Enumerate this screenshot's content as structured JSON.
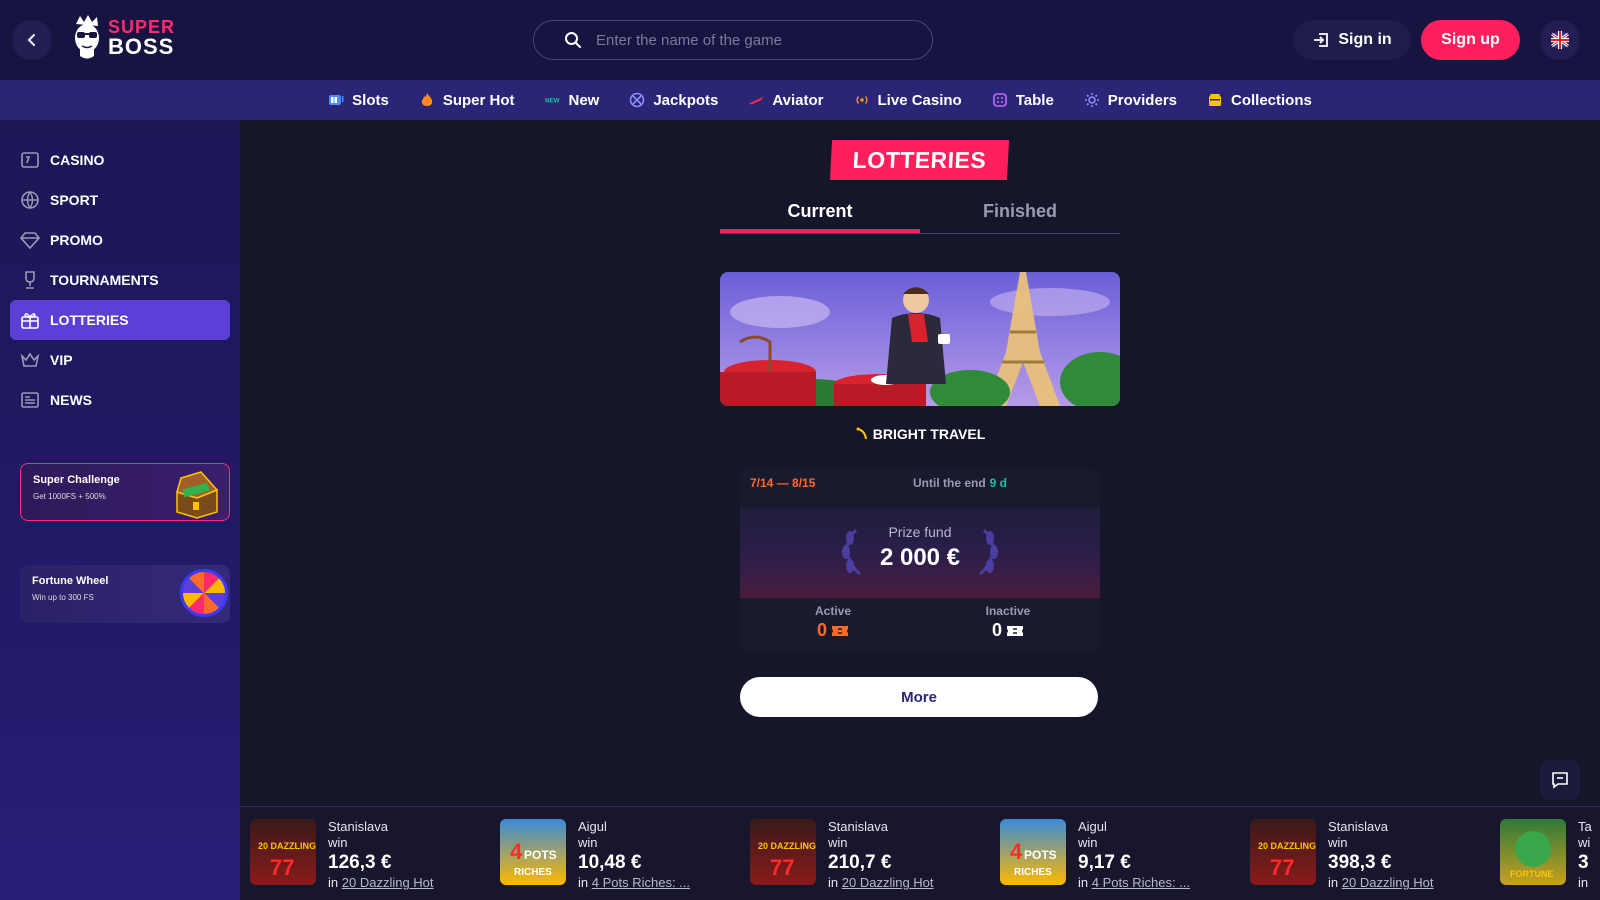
{
  "header": {
    "logo_top": "SUPER",
    "logo_bottom": "BOSS",
    "search_placeholder": "Enter the name of the game",
    "sign_in": "Sign in",
    "sign_up": "Sign up"
  },
  "nav": {
    "items": [
      {
        "label": "Slots",
        "icon": "slots-icon"
      },
      {
        "label": "Super Hot",
        "icon": "fire-icon"
      },
      {
        "label": "New",
        "icon": "new-icon"
      },
      {
        "label": "Jackpots",
        "icon": "jackpot-icon"
      },
      {
        "label": "Aviator",
        "icon": "plane-icon"
      },
      {
        "label": "Live Casino",
        "icon": "live-icon"
      },
      {
        "label": "Table",
        "icon": "dice-icon"
      },
      {
        "label": "Providers",
        "icon": "gear-icon"
      },
      {
        "label": "Collections",
        "icon": "collection-icon"
      }
    ]
  },
  "sidebar": {
    "items": [
      {
        "label": "CASINO"
      },
      {
        "label": "SPORT"
      },
      {
        "label": "PROMO"
      },
      {
        "label": "TOURNAMENTS"
      },
      {
        "label": "LOTTERIES",
        "active": true
      },
      {
        "label": "VIP"
      },
      {
        "label": "NEWS"
      }
    ],
    "challenge": {
      "title": "Super Challenge",
      "subtitle": "Get 1000FS + 500%"
    },
    "fortune": {
      "title": "Fortune Wheel",
      "subtitle": "Win up to 300 FS"
    },
    "watermark": "SUPER BOSS"
  },
  "main": {
    "title": "LOTTERIES",
    "tabs": [
      {
        "label": "Current",
        "active": true
      },
      {
        "label": "Finished",
        "active": false
      }
    ],
    "lottery": {
      "name": "BRIGHT TRAVEL",
      "dates": "7/14 — 8/15",
      "until_label": "Until the end",
      "until_value": "9 d",
      "prize_label": "Prize fund",
      "prize_value": "2 000 €",
      "active_label": "Active",
      "active_value": "0",
      "inactive_label": "Inactive",
      "inactive_value": "0",
      "more": "More"
    }
  },
  "winners": [
    {
      "name": "Stanislava",
      "action": "win",
      "amount": "126,3 €",
      "in": "in",
      "game": "20 Dazzling Hot"
    },
    {
      "name": "Aigul",
      "action": "win",
      "amount": "10,48 €",
      "in": "in",
      "game": "4 Pots Riches: ..."
    },
    {
      "name": "Stanislava",
      "action": "win",
      "amount": "210,7 €",
      "in": "in",
      "game": "20 Dazzling Hot"
    },
    {
      "name": "Aigul",
      "action": "win",
      "amount": "9,17 €",
      "in": "in",
      "game": "4 Pots Riches: ..."
    },
    {
      "name": "Stanislava",
      "action": "win",
      "amount": "398,3 €",
      "in": "in",
      "game": "20 Dazzling Hot"
    },
    {
      "name": "Ta",
      "action": "wi",
      "amount": "3",
      "in": "in",
      "game": ""
    }
  ],
  "colors": {
    "accent": "#ff1f5c",
    "header_bg": "#171441",
    "nav_bg": "#2a2574",
    "sidebar_active": "#5b3fd6",
    "teal": "#19c2a0",
    "orange": "#ff6a2a"
  }
}
